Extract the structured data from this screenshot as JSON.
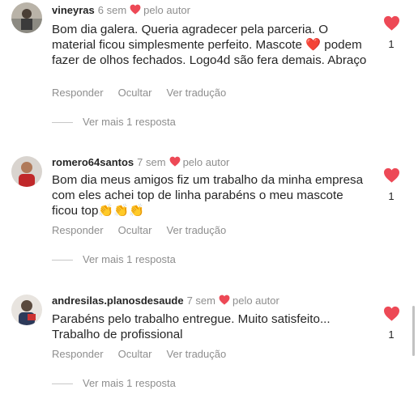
{
  "comments": [
    {
      "username": "vineyras",
      "time": "6 sem",
      "author_label": "pelo autor",
      "text": "Bom dia galera. Queria agradecer pela parceria. O material ficou simplesmente perfeito. Mascote ❤️ podem fazer de olhos fechados. Logo4d são fera demais. Abraço",
      "reply_label": "Responder",
      "hide_label": "Ocultar",
      "translate_label": "Ver tradução",
      "more_replies": "Ver mais 1 resposta",
      "like_count": "1"
    },
    {
      "username": "romero64santos",
      "time": "7 sem",
      "author_label": "pelo autor",
      "text": "Bom dia meus amigos fiz um trabalho da minha empresa com eles achei top de linha parabéns o meu mascote ficou top👏👏👏",
      "reply_label": "Responder",
      "hide_label": "Ocultar",
      "translate_label": "Ver tradução",
      "more_replies": "Ver mais 1 resposta",
      "like_count": "1"
    },
    {
      "username": "andresilas.planosdesaude",
      "time": "7 sem",
      "author_label": "pelo autor",
      "text": "Parabéns pelo trabalho entregue. Muito satisfeito... Trabalho de profissional",
      "reply_label": "Responder",
      "hide_label": "Ocultar",
      "translate_label": "Ver tradução",
      "more_replies": "Ver mais 1 resposta",
      "like_count": "1"
    }
  ],
  "colors": {
    "like_red": "#ed4956",
    "muted": "#8e8e8e",
    "text": "#262626"
  },
  "icons": {
    "author_like": "heart-icon",
    "like": "heart-icon",
    "avatar": "avatar"
  }
}
